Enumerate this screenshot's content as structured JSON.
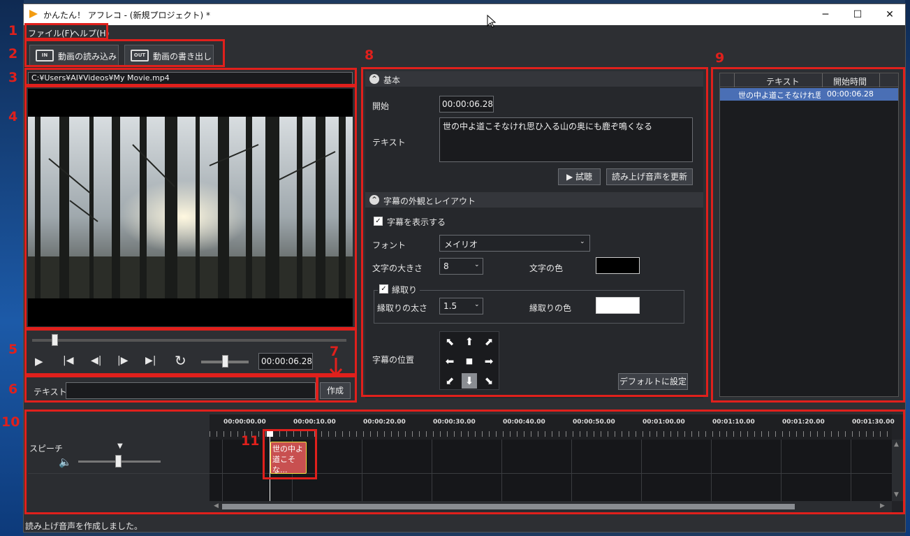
{
  "window": {
    "title": "かんたん！ アフレコ - (新規プロジェクト) *",
    "minimize": "─",
    "maximize": "☐",
    "close": "✕"
  },
  "menu": {
    "file": "ファイル(F)",
    "help": "ヘルプ(H)"
  },
  "toolbar": {
    "import_label": "動画の読み込み",
    "import_icon": "IN",
    "export_label": "動画の書き出し",
    "export_icon": "OUT"
  },
  "video": {
    "path": "C:¥Users¥AI¥Videos¥My Movie.mp4"
  },
  "player": {
    "time": "00:00:06.28",
    "play_icon": "▶",
    "first_icon": "⏮",
    "prev_icon": "◀",
    "next_icon": "▶",
    "last_icon": "⏭",
    "loop_icon": "↻",
    "seek_position": 0.07,
    "volume_position": 0.5
  },
  "quick_text": {
    "label": "テキスト",
    "value": "",
    "create_button": "作成"
  },
  "basic": {
    "header": "基本",
    "start_label": "開始",
    "start_value": "00:00:06.28",
    "text_label": "テキスト",
    "text_value": "世の中よ道こそなけれ思ひ入る山の奥にも鹿ぞ鳴くなる",
    "preview_button": "▶ 試聴",
    "update_button": "読み上げ音声を更新"
  },
  "layout": {
    "header": "字幕の外観とレイアウト",
    "show_subtitle": "字幕を表示する",
    "show_subtitle_checked": true,
    "font_label": "フォント",
    "font_value": "メイリオ",
    "size_label": "文字の大きさ",
    "size_value": "8",
    "color_label": "文字の色",
    "color_value": "#000000",
    "outline_label": "縁取り",
    "outline_checked": true,
    "outline_width_label": "縁取りの太さ",
    "outline_width_value": "1.5",
    "outline_color_label": "縁取りの色",
    "outline_color_value": "#ffffff",
    "position_label": "字幕の位置",
    "position_arrows": [
      "⬉",
      "⬆",
      "⬈",
      "⬅",
      "■",
      "➡",
      "⬋",
      "⬇",
      "⬊"
    ],
    "default_button": "デフォルトに設定"
  },
  "list": {
    "col_text": "テキスト",
    "col_start": "開始時間",
    "rows": [
      {
        "text": "世の中よ道こそなけれ思ひ",
        "start": "00:00:06.28"
      }
    ]
  },
  "timeline": {
    "track_label": "スピーチ",
    "ticks": [
      "00:00:00.00",
      "00:00:10.00",
      "00:00:20.00",
      "00:00:30.00",
      "00:00:40.00",
      "00:00:50.00",
      "00:01:00.00",
      "00:01:10.00",
      "00:01:20.00",
      "00:01:30.00"
    ],
    "clip_text": "世の中よ 道こそな...",
    "volume_position": 0.5
  },
  "status": {
    "text": "読み上げ音声を作成しました。"
  },
  "annotations": [
    "1",
    "2",
    "3",
    "4",
    "5",
    "6",
    "7",
    "8",
    "9",
    "10",
    "11"
  ],
  "colors": {
    "annotation": "#e0201c",
    "selection": "#4a6fb5",
    "clip": "#c85050"
  }
}
